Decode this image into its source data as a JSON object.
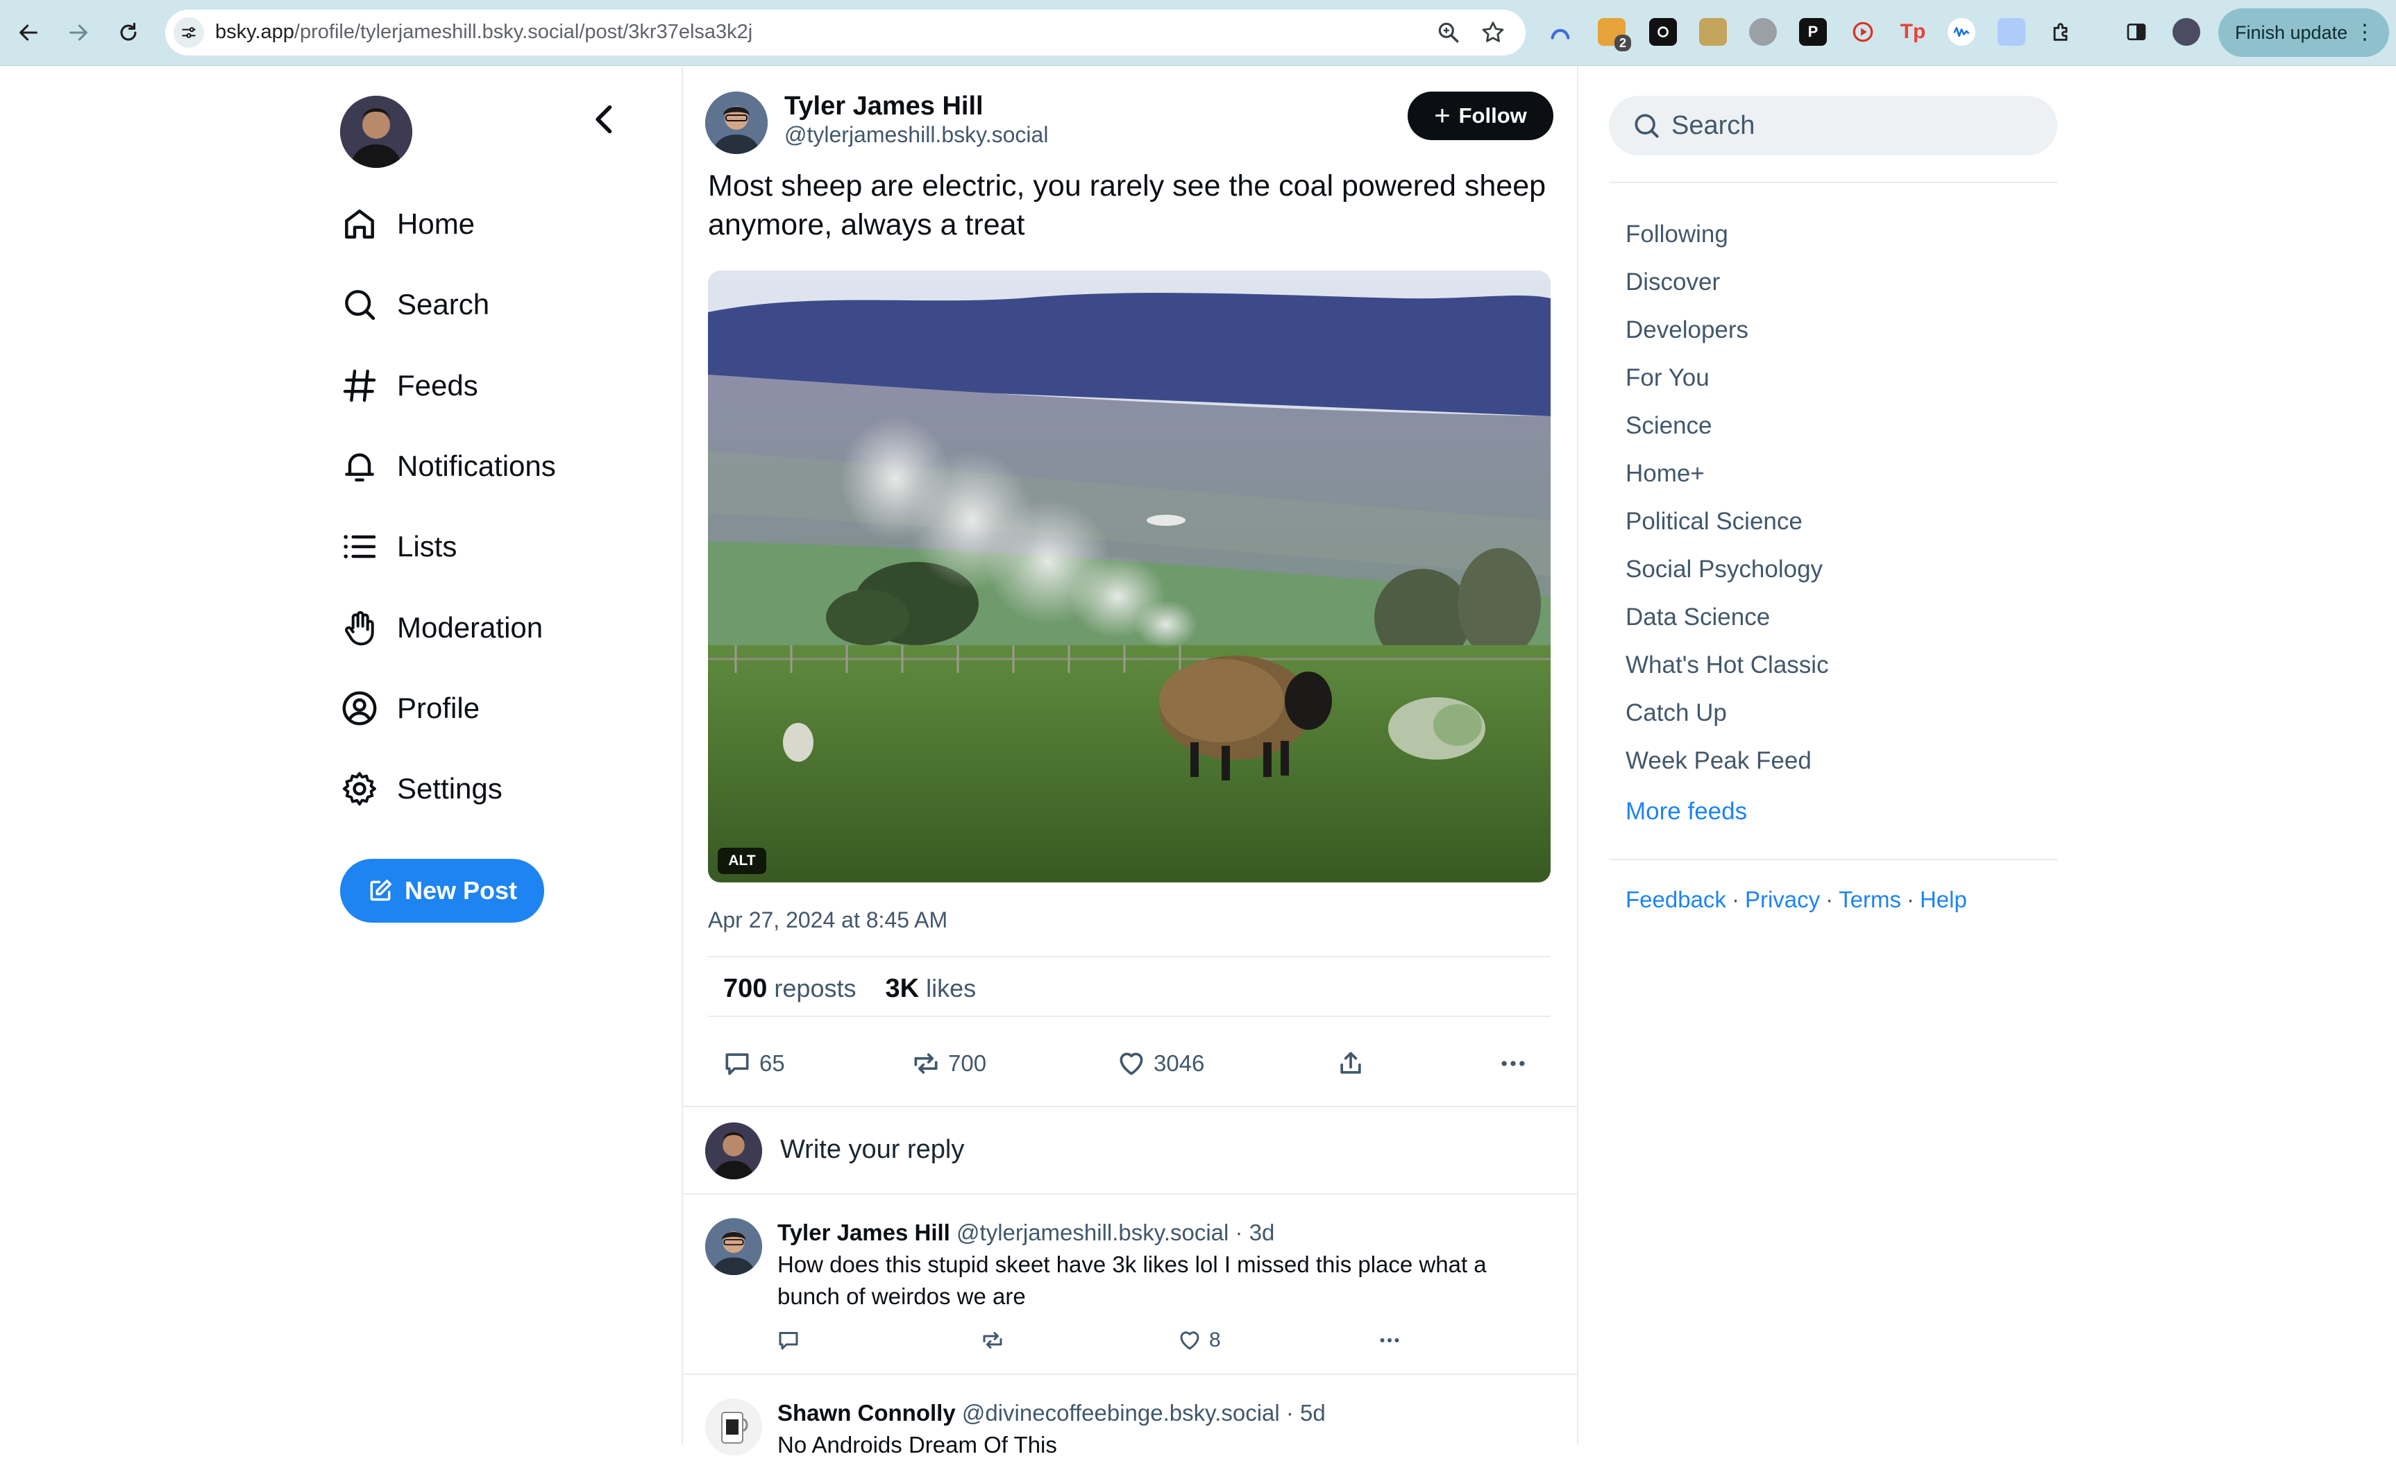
{
  "browser": {
    "url_host": "bsky.app",
    "url_path": "/profile/tylerjameshill.bsky.social/post/3kr37elsa3k2j",
    "finish_update_label": "Finish update",
    "extension_badge": "2"
  },
  "sidebar": {
    "items": [
      {
        "label": "Home",
        "icon": "home-icon"
      },
      {
        "label": "Search",
        "icon": "search-icon"
      },
      {
        "label": "Feeds",
        "icon": "hash-icon"
      },
      {
        "label": "Notifications",
        "icon": "bell-icon"
      },
      {
        "label": "Lists",
        "icon": "list-icon"
      },
      {
        "label": "Moderation",
        "icon": "hand-icon"
      },
      {
        "label": "Profile",
        "icon": "user-circle-icon"
      },
      {
        "label": "Settings",
        "icon": "gear-icon"
      }
    ],
    "new_post_label": "New Post"
  },
  "post": {
    "author_name": "Tyler James Hill",
    "author_handle": "@tylerjameshill.bsky.social",
    "follow_label": "Follow",
    "text": "Most sheep are electric, you rarely see the coal powered sheep anymore, always a treat",
    "image_alt_badge": "ALT",
    "timestamp": "Apr 27, 2024 at 8:45 AM",
    "stats": {
      "reposts_count": "700",
      "reposts_label": "reposts",
      "likes_count": "3K",
      "likes_label": "likes"
    },
    "actions": {
      "replies": "65",
      "reposts": "700",
      "likes": "3046"
    }
  },
  "reply_composer": {
    "placeholder": "Write your reply"
  },
  "comments": [
    {
      "name": "Tyler James Hill",
      "handle": "@tylerjameshill.bsky.social",
      "time": "· 3d",
      "text": "How does this stupid skeet have 3k likes lol I missed this place what a bunch of weirdos we are",
      "likes": "8"
    },
    {
      "name": "Shawn Connolly",
      "handle": "@divinecoffeebinge.bsky.social",
      "time": "· 5d",
      "text": "No Androids Dream Of This"
    }
  ],
  "right": {
    "search_placeholder": "Search",
    "feeds": [
      "Following",
      "Discover",
      "Developers",
      "For You",
      "Science",
      "Home+",
      "Political Science",
      "Social Psychology",
      "Data Science",
      "What's Hot Classic",
      "Catch Up",
      "Week Peak Feed"
    ],
    "more_feeds": "More feeds",
    "footer": [
      "Feedback",
      "Privacy",
      "Terms",
      "Help"
    ]
  },
  "colors": {
    "accent": "#1d84f1",
    "chrome": "#cfe6ec",
    "muted_text": "#42576c"
  }
}
